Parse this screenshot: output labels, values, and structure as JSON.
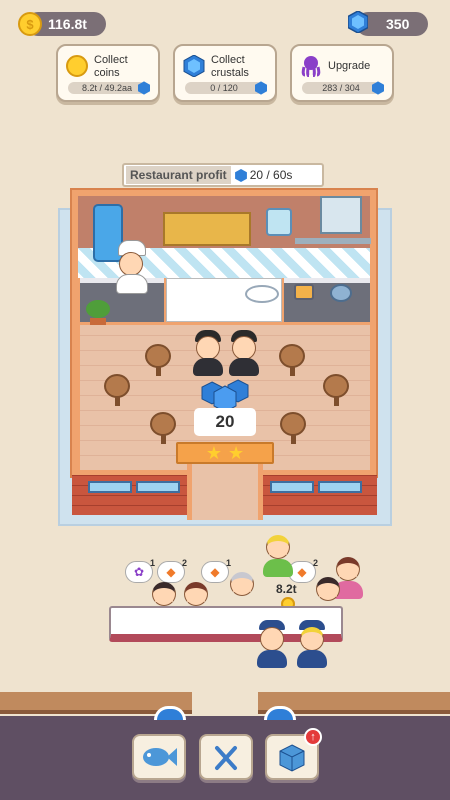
{
  "top": {
    "coins": "116.8t",
    "gems": "350"
  },
  "cards": [
    {
      "title": "Collect coins",
      "progress": "8.2t / 49.2aa",
      "icon": "coin-icon"
    },
    {
      "title": "Collect crustals",
      "progress": "0 / 120",
      "icon": "crystal-icon"
    },
    {
      "title": "Upgrade",
      "progress": "283 / 304",
      "icon": "octopus-icon"
    }
  ],
  "restaurant": {
    "profit_label": "Restaurant profit",
    "profit_value": "20 / 60s",
    "gem_reward": "20"
  },
  "queue": {
    "coin_amount": "8.2t",
    "bubble_counts": [
      "1",
      "2",
      "1",
      "2"
    ]
  },
  "bottom_nav": [
    "fish-icon",
    "utensils-icon",
    "box-icon"
  ],
  "colors": {
    "accent_blue": "#2f7fd8",
    "coin_gold": "#ffce2e",
    "bottom_bar": "#5f4f63"
  }
}
